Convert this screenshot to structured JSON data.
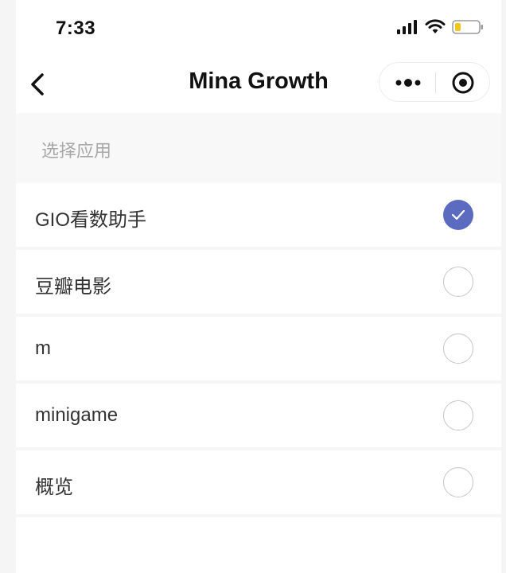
{
  "status_bar": {
    "time": "7:33",
    "icons": [
      "signal-icon",
      "wifi-icon",
      "battery-icon"
    ]
  },
  "nav": {
    "title": "Mina Growth",
    "back_icon": "chevron-left-icon",
    "capsule": [
      "more-dots-icon",
      "target-close-icon"
    ]
  },
  "section": {
    "label": "选择应用"
  },
  "apps": [
    {
      "label": "GIO看数助手",
      "selected": true
    },
    {
      "label": "豆瓣电影",
      "selected": false
    },
    {
      "label": "m",
      "selected": false
    },
    {
      "label": "minigame",
      "selected": false
    },
    {
      "label": "概览",
      "selected": false
    }
  ],
  "colors": {
    "accent": "#5b6bbf",
    "battery_level": "#f5c518"
  }
}
